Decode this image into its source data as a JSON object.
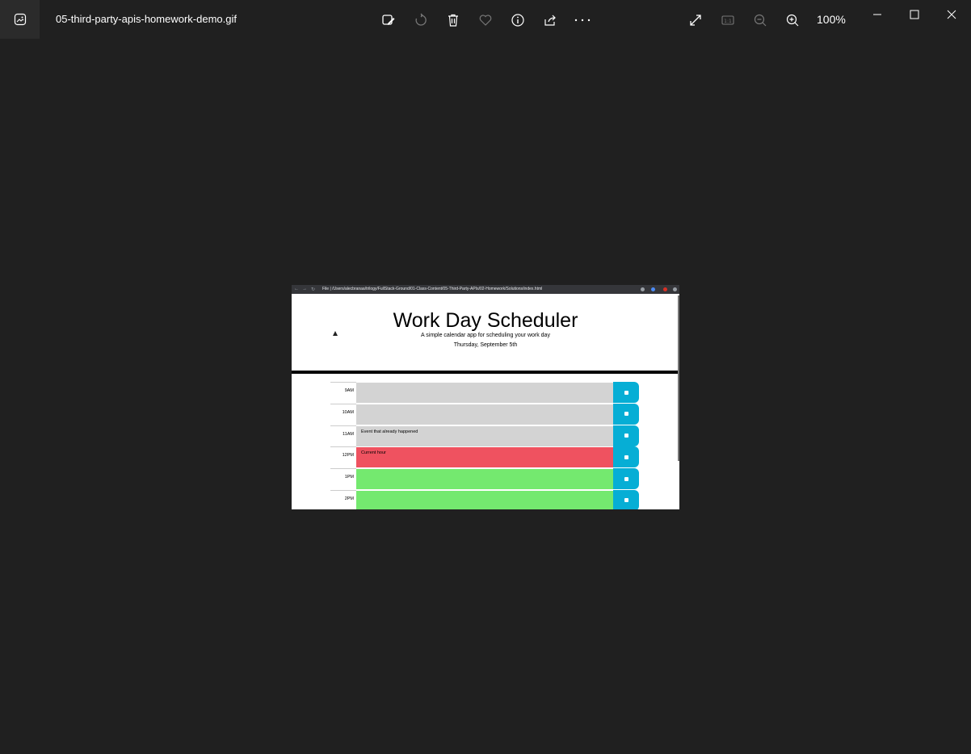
{
  "window": {
    "filename": "05-third-party-apis-homework-demo.gif",
    "zoom": "100%"
  },
  "toolbar": {
    "icons": [
      "edit-image-icon",
      "rotate-icon",
      "delete-icon",
      "favorite-icon",
      "info-icon",
      "share-icon",
      "more-icon"
    ],
    "right_icons": [
      "fullscreen-icon",
      "actual-size-icon",
      "zoom-out-icon",
      "zoom-in-icon"
    ]
  },
  "browser": {
    "url": "File  |  /Users/alecbranaa/trilogy/FullStack-Ground/01-Class-Content/05-Third-Party-APIs/02-Homework/Solutions/index.html"
  },
  "scheduler": {
    "title": "Work Day Scheduler",
    "lead": "A simple calendar app for scheduling your work day",
    "date": "Thursday, September 5th",
    "rows": [
      {
        "hour": "9AM",
        "text": "",
        "state": "past"
      },
      {
        "hour": "10AM",
        "text": "",
        "state": "past"
      },
      {
        "hour": "11AM",
        "text": "Event that already happened",
        "state": "past"
      },
      {
        "hour": "12PM",
        "text": "Current hour",
        "state": "present"
      },
      {
        "hour": "1PM",
        "text": "",
        "state": "future"
      },
      {
        "hour": "2PM",
        "text": "",
        "state": "future"
      }
    ]
  },
  "colors": {
    "past": "#d3d3d3",
    "present": "#ef5260",
    "future": "#74e96f",
    "save": "#06aed5"
  }
}
